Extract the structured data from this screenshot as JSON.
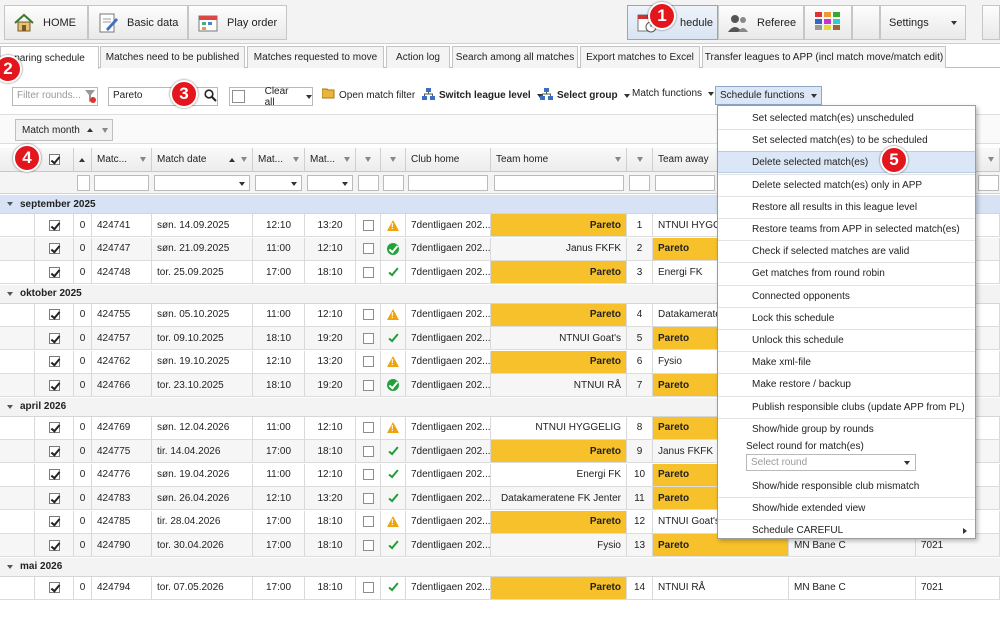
{
  "toolbar": {
    "home": "HOME",
    "basic_data": "Basic data",
    "play_order": "Play order",
    "schedule": "hedule",
    "referee": "Referee",
    "settings": "Settings"
  },
  "tabs": [
    "paring schedule",
    "Matches need to be published",
    "Matches requested to move",
    "Action log",
    "Search among all matches",
    "Export matches to Excel",
    "Transfer leagues to APP (incl match move/match edit)"
  ],
  "filterbar": {
    "rounds_placeholder": "Filter rounds...",
    "team_search_value": "Pareto",
    "clear_all": "Clear all",
    "open_match_filter": "Open match filter",
    "switch_league_level": "Switch league level",
    "select_group": "Select group",
    "match_functions": "Match functions",
    "schedule_functions": "Schedule functions"
  },
  "group_chip": "Match month",
  "columns": [
    "Matc...",
    "Match date",
    "Mat...",
    "Mat...",
    "Club home",
    "Team home",
    "Team away"
  ],
  "groups": [
    {
      "label": "september 2025",
      "rows": [
        {
          "n": "0",
          "id": "424741",
          "date": "søn. 14.09.2025",
          "t1": "12:10",
          "t2": "13:20",
          "status": "warn",
          "club": "7dentligaen 202...",
          "home": "Pareto",
          "home_hl": true,
          "round": "1",
          "away": "NTNUI HYGGE",
          "away_hl": false
        },
        {
          "n": "0",
          "id": "424747",
          "date": "søn. 21.09.2025",
          "t1": "11:00",
          "t2": "12:10",
          "status": "okc",
          "club": "7dentligaen 202...",
          "home": "Janus FKFK",
          "home_hl": false,
          "round": "2",
          "away": "Pareto",
          "away_hl": true
        },
        {
          "n": "0",
          "id": "424748",
          "date": "tor. 25.09.2025",
          "t1": "17:00",
          "t2": "18:10",
          "status": "tick",
          "club": "7dentligaen 202...",
          "home": "Pareto",
          "home_hl": true,
          "round": "3",
          "away": "Energi FK",
          "away_hl": false
        }
      ]
    },
    {
      "label": "oktober 2025",
      "rows": [
        {
          "n": "0",
          "id": "424755",
          "date": "søn. 05.10.2025",
          "t1": "11:00",
          "t2": "12:10",
          "status": "warn",
          "club": "7dentligaen 202...",
          "home": "Pareto",
          "home_hl": true,
          "round": "4",
          "away": "Datakamerate",
          "away_hl": false
        },
        {
          "n": "0",
          "id": "424757",
          "date": "tor. 09.10.2025",
          "t1": "18:10",
          "t2": "19:20",
          "status": "tick",
          "club": "7dentligaen 202...",
          "home": "NTNUI Goat's",
          "home_hl": false,
          "round": "5",
          "away": "Pareto",
          "away_hl": true
        },
        {
          "n": "0",
          "id": "424762",
          "date": "søn. 19.10.2025",
          "t1": "12:10",
          "t2": "13:20",
          "status": "warn",
          "club": "7dentligaen 202...",
          "home": "Pareto",
          "home_hl": true,
          "round": "6",
          "away": "Fysio",
          "away_hl": false
        },
        {
          "n": "0",
          "id": "424766",
          "date": "tor. 23.10.2025",
          "t1": "18:10",
          "t2": "19:20",
          "status": "okc",
          "club": "7dentligaen 202...",
          "home": "NTNUI RÅ",
          "home_hl": false,
          "round": "7",
          "away": "Pareto",
          "away_hl": true
        }
      ]
    },
    {
      "label": "april 2026",
      "rows": [
        {
          "n": "0",
          "id": "424769",
          "date": "søn. 12.04.2026",
          "t1": "11:00",
          "t2": "12:10",
          "status": "warn",
          "club": "7dentligaen 202...",
          "home": "NTNUI HYGGELIG",
          "home_hl": false,
          "round": "8",
          "away": "Pareto",
          "away_hl": true
        },
        {
          "n": "0",
          "id": "424775",
          "date": "tir. 14.04.2026",
          "t1": "17:00",
          "t2": "18:10",
          "status": "tick",
          "club": "7dentligaen 202...",
          "home": "Pareto",
          "home_hl": true,
          "round": "9",
          "away": "Janus FKFK",
          "away_hl": false
        },
        {
          "n": "0",
          "id": "424776",
          "date": "søn. 19.04.2026",
          "t1": "11:00",
          "t2": "12:10",
          "status": "tick",
          "club": "7dentligaen 202...",
          "home": "Energi FK",
          "home_hl": false,
          "round": "10",
          "away": "Pareto",
          "away_hl": true
        },
        {
          "n": "0",
          "id": "424783",
          "date": "søn. 26.04.2026",
          "t1": "12:10",
          "t2": "13:20",
          "status": "tick",
          "club": "7dentligaen 202...",
          "home": "Datakameratene FK Jenter",
          "home_hl": false,
          "round": "11",
          "away": "Pareto",
          "away_hl": true
        },
        {
          "n": "0",
          "id": "424785",
          "date": "tir. 28.04.2026",
          "t1": "17:00",
          "t2": "18:10",
          "status": "warn",
          "club": "7dentligaen 202...",
          "home": "Pareto",
          "home_hl": true,
          "round": "12",
          "away": "NTNUI Goat's",
          "away_hl": false
        },
        {
          "n": "0",
          "id": "424790",
          "date": "tor. 30.04.2026",
          "t1": "17:00",
          "t2": "18:10",
          "status": "tick",
          "club": "7dentligaen 202...",
          "home": "Fysio",
          "home_hl": false,
          "round": "13",
          "away": "Pareto",
          "away_hl": true,
          "venue": "MN Bane C",
          "code": "7021"
        }
      ]
    },
    {
      "label": "mai 2026",
      "rows": [
        {
          "n": "0",
          "id": "424794",
          "date": "tor. 07.05.2026",
          "t1": "17:00",
          "t2": "18:10",
          "status": "tick",
          "club": "7dentligaen 202...",
          "home": "Pareto",
          "home_hl": true,
          "round": "14",
          "away": "NTNUI RÅ",
          "away_hl": false,
          "venue": "MN Bane C",
          "code": "7021"
        }
      ]
    }
  ],
  "schedule_menu": {
    "items": [
      "Set selected match(es) unscheduled",
      "Set selected match(es) to be scheduled",
      "Delete selected match(es)",
      "Delete selected match(es) only in APP",
      "Restore all results in this league level",
      "Restore teams from APP in selected match(es)",
      "Check if selected matches are valid",
      "Get matches from round robin",
      "Connected opponents",
      "Lock this schedule",
      "Unlock this schedule",
      "Make xml-file",
      "Make restore / backup",
      "Publish responsible clubs (update APP from PL)",
      "Show/hide group by rounds"
    ],
    "round_label": "Select round for match(es)",
    "round_placeholder": "Select round",
    "items_after": [
      "Show/hide responsible club mismatch",
      "Show/hide extended view",
      "Schedule CAREFUL"
    ]
  },
  "annotations": [
    "1",
    "2",
    "3",
    "4",
    "5"
  ],
  "colors": {
    "highlight": "#f6c12a",
    "badge": "#e2161c",
    "menu_hover": "#dbe7f6"
  }
}
